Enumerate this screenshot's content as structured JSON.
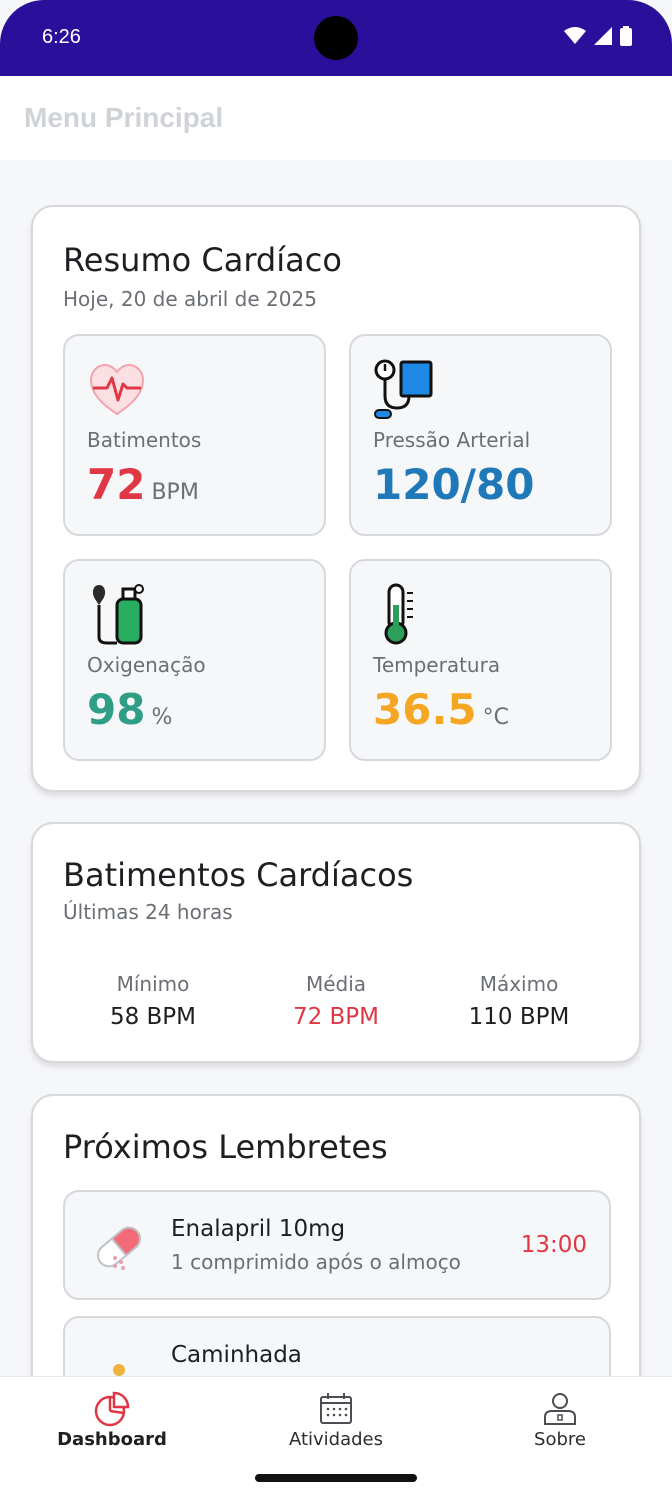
{
  "status_bar": {
    "time": "6:26",
    "icons": [
      "wifi-icon",
      "cell-signal-icon",
      "battery-icon"
    ],
    "background": "#2a0f9a"
  },
  "app_bar": {
    "title": "Menu Principal"
  },
  "summary": {
    "title": "Resumo Cardíaco",
    "date": "Hoje, 20 de abril de 2025",
    "metrics": [
      {
        "icon": "heart-rate-icon",
        "label": "Batimentos",
        "value": "72",
        "unit": "BPM",
        "color": "#e03745"
      },
      {
        "icon": "blood-pressure-icon",
        "label": "Pressão Arterial",
        "value": "120/80",
        "unit": "",
        "color": "#1f78b8"
      },
      {
        "icon": "oxygen-tank-icon",
        "label": "Oxigenação",
        "value": "98",
        "unit": "%",
        "color": "#2e9f86"
      },
      {
        "icon": "thermometer-icon",
        "label": "Temperatura",
        "value": "36.5",
        "unit": "°C",
        "color": "#f5a623"
      }
    ]
  },
  "heart_rate": {
    "title": "Batimentos Cardíacos",
    "subtitle": "Últimas 24 horas",
    "stats": [
      {
        "label": "Mínimo",
        "value": "58 BPM",
        "color": "#1d1f22"
      },
      {
        "label": "Média",
        "value": "72 BPM",
        "color": "#e03745"
      },
      {
        "label": "Máximo",
        "value": "110 BPM",
        "color": "#1d1f22"
      }
    ]
  },
  "reminders": {
    "title": "Próximos Lembretes",
    "items": [
      {
        "icon": "pill-icon",
        "title": "Enalapril 10mg",
        "description": "1 comprimido após o almoço",
        "time": "13:00"
      },
      {
        "icon": "walking-person-icon",
        "title": "Caminhada",
        "description": "",
        "time": ""
      }
    ]
  },
  "bottom_nav": {
    "items": [
      {
        "icon": "dashboard-pie-icon",
        "label": "Dashboard",
        "active": true,
        "color": "#e03745"
      },
      {
        "icon": "calendar-icon",
        "label": "Atividades",
        "active": false
      },
      {
        "icon": "profile-icon",
        "label": "Sobre",
        "active": false
      }
    ]
  }
}
